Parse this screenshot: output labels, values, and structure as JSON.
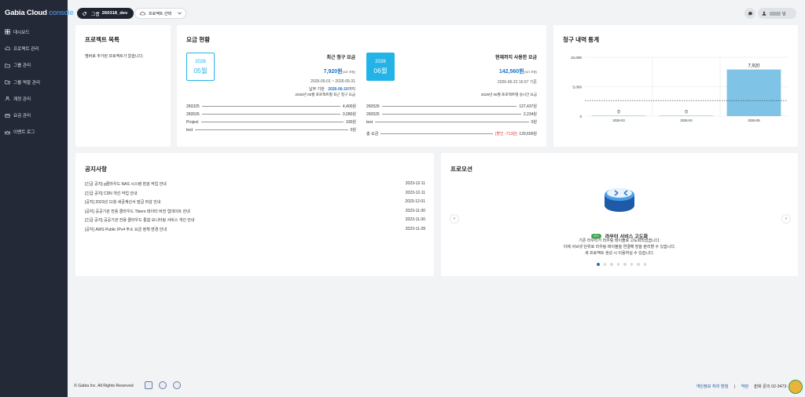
{
  "brand": {
    "name": "Gabia Cloud",
    "suffix": "console"
  },
  "sidebar": {
    "items": [
      {
        "label": "대시보드",
        "icon": "dashboard-icon"
      },
      {
        "label": "프로젝트 관리",
        "icon": "cloud-icon"
      },
      {
        "label": "그룹 관리",
        "icon": "folder-icon"
      },
      {
        "label": "그룹 역할 관리",
        "icon": "folder-user-icon"
      },
      {
        "label": "계정 관리",
        "icon": "account-icon"
      },
      {
        "label": "요금 관리",
        "icon": "billing-icon"
      },
      {
        "label": "이벤트 로그",
        "icon": "event-log-icon"
      }
    ]
  },
  "topbar": {
    "group_prefix": "그룹",
    "group_name": "260318_dev",
    "project_select": "프로젝트 선택",
    "user_suffix": "님"
  },
  "projects_card": {
    "title": "프로젝트 목록",
    "empty": "멤버로 추가된 프로젝트가 없습니다."
  },
  "billing_card": {
    "title": "요금 현황",
    "recent": {
      "year": "2026",
      "month": "05월",
      "heading": "최근 청구 요금",
      "amount": "7,920원",
      "vat": "(VAT 포함)",
      "period": "2026-05-01 ~ 2026-05-31",
      "due_label": "납부 기한",
      "due_date": "2026-06-10",
      "due_suffix": "까지",
      "caption": "2026년 05월 프로젝트별 최근 청구 요금",
      "rows": [
        {
          "name": "260325",
          "amount": "4,400원"
        },
        {
          "name": "260526",
          "amount": "3,080원"
        },
        {
          "name": "Project",
          "amount": "330원"
        },
        {
          "name": "test",
          "amount": "0원"
        }
      ]
    },
    "current": {
      "year": "2026",
      "month": "06월",
      "heading": "현재까지 사용한 요금",
      "amount": "142,560원",
      "vat": "(VAT 포함)",
      "timestamp": "2026-06-22 16:57 기준",
      "caption": "2026년 06월 프로젝트별 실시간 요금",
      "rows": [
        {
          "name": "260526",
          "amount": "127,437원"
        },
        {
          "name": "260525",
          "amount": "2,234원"
        },
        {
          "name": "test",
          "amount": "0원"
        }
      ],
      "total_label": "총 요금",
      "discount": "(할인 -713원)",
      "total": "129,600원"
    }
  },
  "history_card": {
    "title": "청구 내역 통계"
  },
  "chart_data": {
    "type": "bar",
    "categories": [
      "2026-03",
      "2026-04",
      "2026-05"
    ],
    "values": [
      0,
      0,
      7920
    ],
    "value_labels": [
      "0",
      "0",
      "7,920"
    ],
    "yticks": [
      "10,000",
      "5,000",
      "0"
    ],
    "ylim": [
      0,
      10000
    ],
    "average_line": 2640,
    "bar_color": "#7fc4e6",
    "title": "",
    "xlabel": "",
    "ylabel": ""
  },
  "notice_card": {
    "title": "공지사항",
    "items": [
      {
        "text": "[긴급 공지] g클라우드 NAS 시스템 점검 작업 안내",
        "date": "2023-12-11"
      },
      {
        "text": "[긴급 공지] CDN 개선 작업 안내",
        "date": "2023-12-11"
      },
      {
        "text": "[공지] 2023년 11월 세금계산서 발급 마감 안내",
        "date": "2023-12-01"
      },
      {
        "text": "[공지] 공공기관 전용 클라우드 Tibero 데이터 버전 업데이트 안내",
        "date": "2023-11-30"
      },
      {
        "text": "[긴급 공지] 공공기관 전용 클라우드 통합 모니터링 서비스 개선 안내",
        "date": "2023-11-30"
      },
      {
        "text": "[공지] AWS Public IPv4 주소 요금 정책 변경 안내",
        "date": "2023-11-28"
      }
    ]
  },
  "promo_card": {
    "title": "프로모션",
    "badge": "VPC",
    "heading": "라우터 서비스 고도화",
    "lines": [
      "기존 라우터가 라우팅 테이블로 고도화되었습니다.",
      "이제 서브넷 단위로 라우팅 테이블을 연결해 망을 분리할 수 있습니다.",
      "새 프로젝트 생성 시 이용하실 수 있습니다."
    ],
    "slides_total": 8,
    "slide_active": 1
  },
  "footer": {
    "copyright": "© Gabia Inc. All Rights Reserved",
    "privacy": "개인정보 처리 방침",
    "terms": "약관",
    "separator": "|",
    "phone": "전화 문의 02-3473-"
  },
  "colors": {
    "sidebar": "#232936",
    "accent": "#22b4e6",
    "link": "#1a73c8",
    "discount": "#e53935"
  }
}
